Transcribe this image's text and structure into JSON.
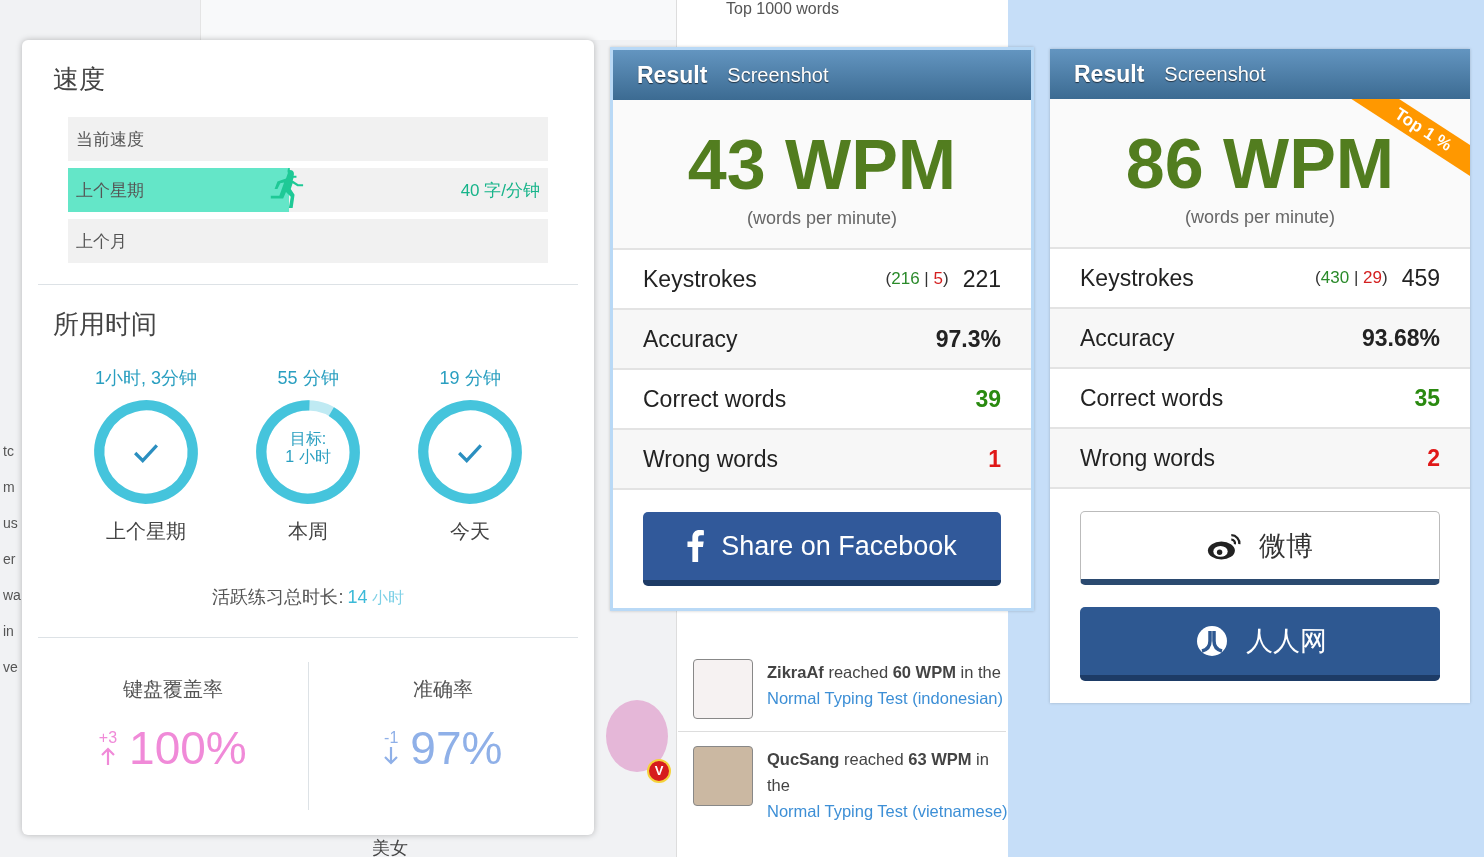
{
  "background": {
    "top_caption": "Top 1000 words",
    "side_fragments": [
      "tc",
      "m",
      "us",
      "er",
      "wa",
      "in",
      "ve"
    ],
    "bottom_caption": "美女",
    "avatar_badge": "V"
  },
  "stats_panel": {
    "speed_title": "速度",
    "speed_rows": [
      {
        "label": "当前速度"
      },
      {
        "label": "上个星期",
        "level": 0.46,
        "reading": "40 字/分钟"
      },
      {
        "label": "上个月"
      }
    ],
    "time_title": "所用时间",
    "time_rings": [
      {
        "duration": "1小时, 3分钟",
        "level": 1,
        "done": true,
        "label": "上个星期"
      },
      {
        "duration": "55 分钟",
        "level": 0.92,
        "done": false,
        "goal_label": "目标:",
        "goal_value": "1 小时",
        "label": "本周"
      },
      {
        "duration": "19 分钟",
        "level": 1,
        "done": true,
        "label": "今天"
      }
    ],
    "total_label": "活跃练习总时长:",
    "total_value": "14",
    "total_unit": "小时",
    "metrics": [
      {
        "title": "键盘覆盖率",
        "delta": "+3",
        "kind": "increase",
        "value": "100%",
        "color": "#f08ad8"
      },
      {
        "title": "准确率",
        "delta": "-1",
        "kind": "decrease",
        "value": "97%",
        "color": "#8fb0e8"
      }
    ]
  },
  "results": [
    {
      "title": "Result",
      "tab": "Screenshot",
      "wpm": "43 WPM",
      "wpm_note": "(words per minute)",
      "rows": [
        {
          "kind": "keystrokes",
          "label": "Keystrokes",
          "open": "(",
          "correct": "216",
          "sep": "|",
          "wrong": "5",
          "close": ")",
          "value": "221"
        },
        {
          "kind": "plain",
          "label": "Accuracy",
          "value": "97.3%"
        },
        {
          "kind": "good",
          "label": "Correct words",
          "value": "39"
        },
        {
          "kind": "bad",
          "label": "Wrong words",
          "value": "1"
        }
      ],
      "share_buttons": [
        {
          "kind": "facebook",
          "label": "Share on Facebook"
        }
      ]
    },
    {
      "title": "Result",
      "tab": "Screenshot",
      "wpm": "86 WPM",
      "wpm_note": "(words per minute)",
      "badge": "Top 1 %",
      "rows": [
        {
          "kind": "keystrokes",
          "label": "Keystrokes",
          "open": "(",
          "correct": "430",
          "sep": "|",
          "wrong": "29",
          "close": ")",
          "value": "459"
        },
        {
          "kind": "plain",
          "label": "Accuracy",
          "value": "93.68%"
        },
        {
          "kind": "good",
          "label": "Correct words",
          "value": "35"
        },
        {
          "kind": "bad",
          "label": "Wrong words",
          "value": "2"
        }
      ],
      "share_buttons": [
        {
          "kind": "weibo",
          "label": "微博"
        },
        {
          "kind": "renren",
          "label": "人人网"
        }
      ]
    }
  ],
  "feed": [
    {
      "text": "**ZikraAf** reached **60 WPM** in the",
      "link": "Normal Typing Test (indonesian)"
    },
    {
      "text": "**QucSang** reached **63 WPM** in the",
      "link": "Normal Typing Test (vietnamese)"
    }
  ]
}
